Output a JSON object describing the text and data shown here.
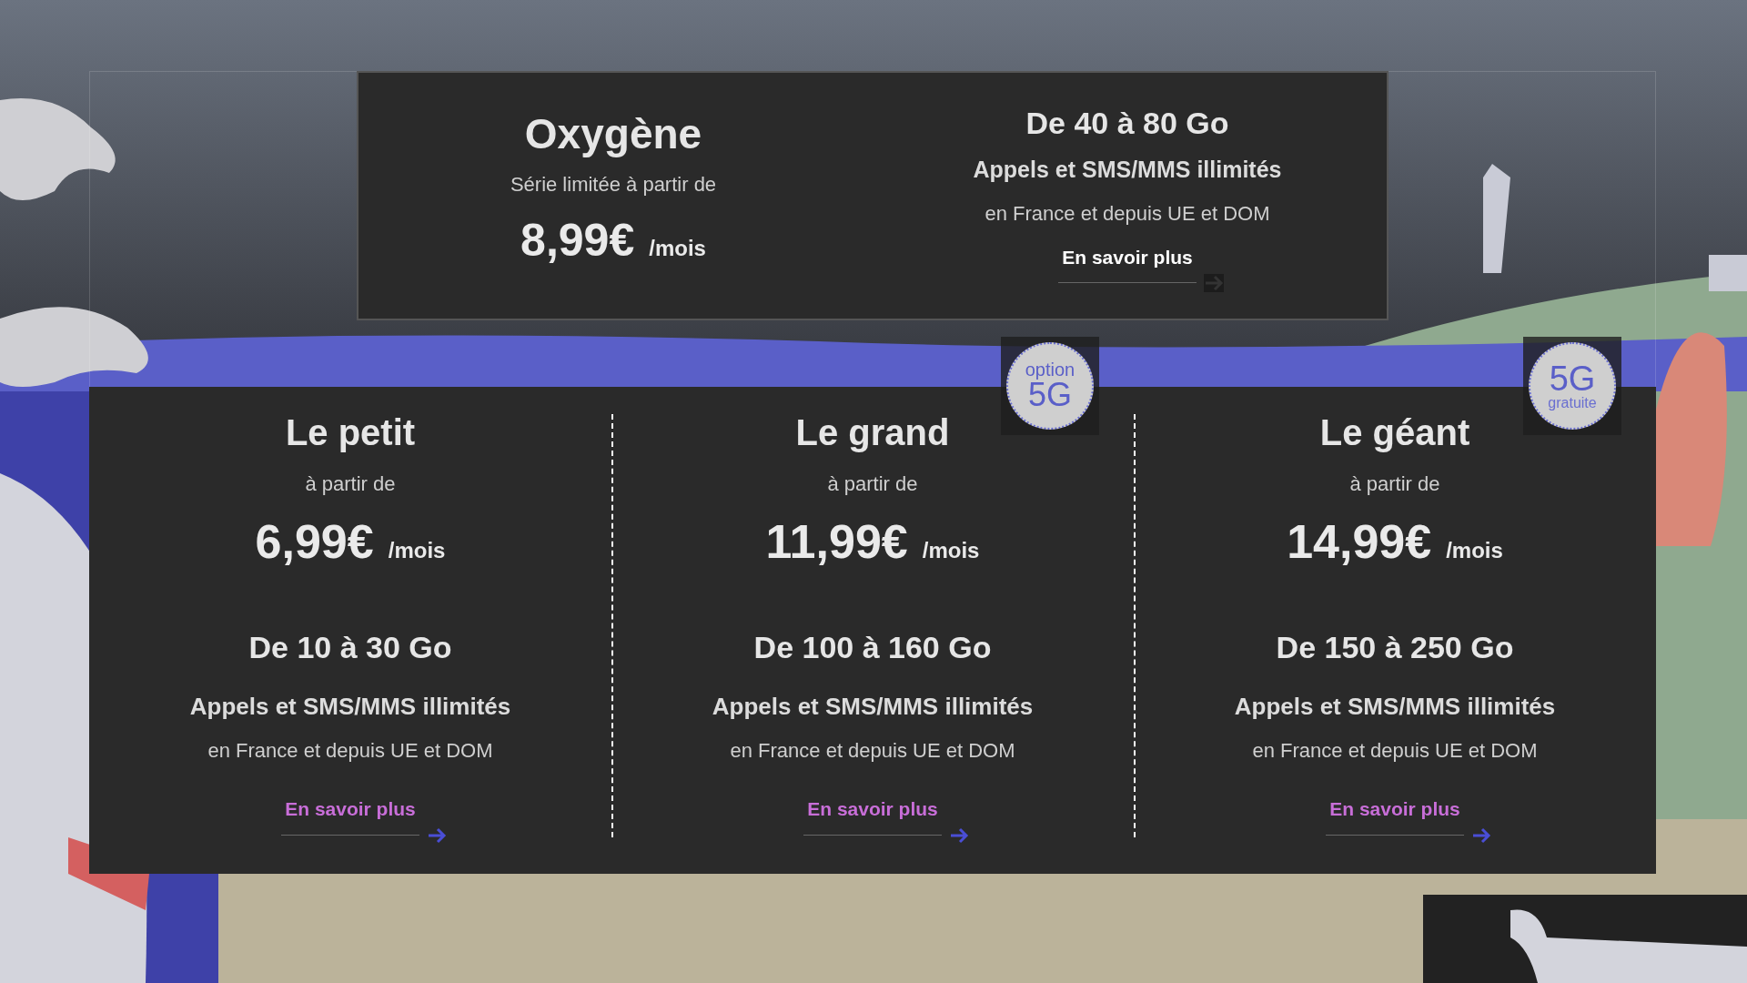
{
  "featured": {
    "title": "Oxygène",
    "subtitle": "Série limitée à partir de",
    "price": "8,99€",
    "period": "/mois",
    "data": "De 40 à 80 Go",
    "calls": "Appels et SMS/MMS illimités",
    "roaming": "en France et depuis UE et DOM",
    "link": "En savoir plus"
  },
  "plans": [
    {
      "title": "Le petit",
      "subtitle": "à partir de",
      "price": "6,99€",
      "period": "/mois",
      "data": "De 10 à 30 Go",
      "calls": "Appels et SMS/MMS illimités",
      "roaming": "en France et depuis UE et DOM",
      "link": "En savoir plus"
    },
    {
      "title": "Le grand",
      "subtitle": "à partir de",
      "price": "11,99€",
      "period": "/mois",
      "data": "De 100 à 160 Go",
      "calls": "Appels et SMS/MMS illimités",
      "roaming": "en France et depuis UE et DOM",
      "link": "En savoir plus",
      "badge": {
        "kind": "option",
        "small": "option",
        "big": "5G"
      }
    },
    {
      "title": "Le géant",
      "subtitle": "à partir de",
      "price": "14,99€",
      "period": "/mois",
      "data": "De 150 à 250 Go",
      "calls": "Appels et SMS/MMS illimités",
      "roaming": "en France et depuis UE et DOM",
      "link": "En savoir plus",
      "badge": {
        "kind": "free",
        "big": "5G",
        "small": "gratuite"
      }
    }
  ]
}
